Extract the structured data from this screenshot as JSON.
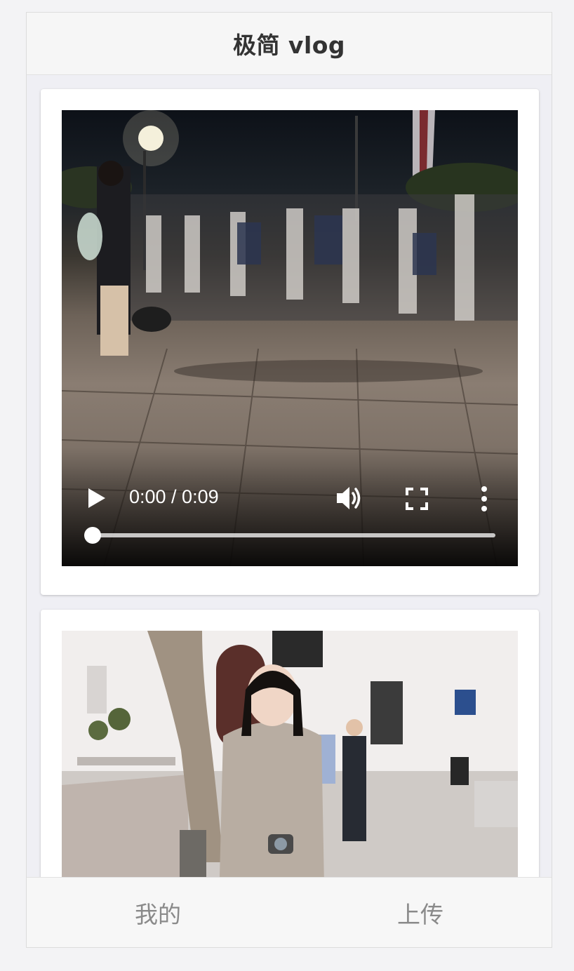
{
  "header": {
    "title": "极简 vlog"
  },
  "feed": {
    "items": [
      {
        "scene": "night street dance crowd",
        "time_display": "0:00 / 0:09",
        "progress": 0,
        "icons": [
          "play-icon",
          "volume-icon",
          "fullscreen-icon",
          "more-vert-icon"
        ]
      },
      {
        "scene": "girl in coat with camera on town street"
      }
    ]
  },
  "tabbar": {
    "tabs": [
      {
        "label": "我的"
      },
      {
        "label": "上传"
      }
    ]
  },
  "colors": {
    "header_bg": "#f6f6f6",
    "page_bg": "#efeff4",
    "tab_text": "#8a8a8a",
    "title_text": "#333333"
  }
}
